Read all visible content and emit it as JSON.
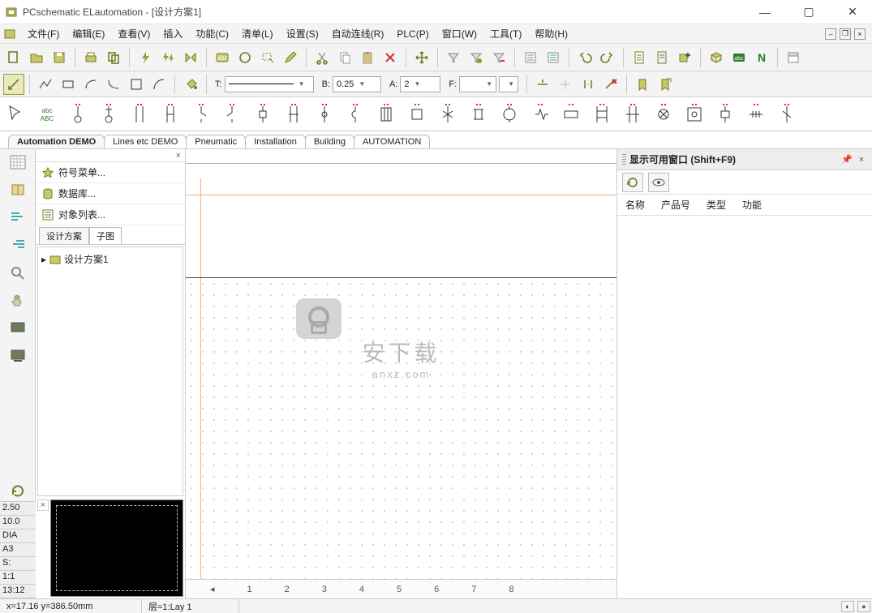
{
  "titlebar": {
    "text": "PCschematic ELautomation - [设计方案1]"
  },
  "menu": {
    "items": [
      "文件(F)",
      "编辑(E)",
      "查看(V)",
      "插入",
      "功能(C)",
      "清单(L)",
      "设置(S)",
      "自动连线(R)",
      "PLC(P)",
      "窗口(W)",
      "工具(T)",
      "帮助(H)"
    ]
  },
  "toolbar2": {
    "T_label": "T:",
    "B_label": "B:",
    "B_value": "0.25",
    "A_label": "A:",
    "A_value": "2",
    "F_label": "F:",
    "F_color": "#000000"
  },
  "tabs": [
    "Automation DEMO",
    "Lines etc DEMO",
    "Pneumatic",
    "Installation",
    "Building",
    "AUTOMATION"
  ],
  "tabs_active": 0,
  "side": {
    "menu1": "符号菜单...",
    "menu2": "数据库...",
    "menu3": "对象列表...",
    "subtabs": [
      "设计方案",
      "子图"
    ],
    "tree_item": "设计方案1"
  },
  "leftinfo": [
    "2.50",
    "10.0",
    "DIA",
    "A3",
    "S:",
    "1:1",
    "13:12"
  ],
  "rightpanel": {
    "title": "显示可用窗口 ",
    "shortcut": "(Shift+F9)",
    "cols": [
      "名称",
      "产品号",
      "类型",
      "功能"
    ]
  },
  "pageticks": [
    "1",
    "2",
    "3",
    "4",
    "5",
    "6",
    "7",
    "8"
  ],
  "status": {
    "coord": "x=17.16 y=386.50mm",
    "layer": "层=1:Lay 1"
  }
}
